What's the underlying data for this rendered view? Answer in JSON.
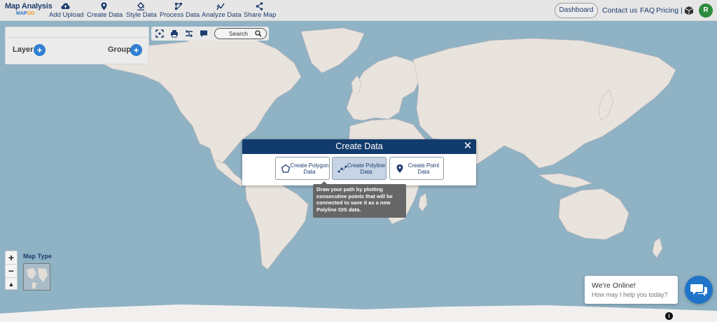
{
  "brand": {
    "title": "Map Analysis",
    "sub_prefix": "MAP",
    "sub_suffix": "OG"
  },
  "nav": {
    "items": [
      {
        "label": "Add Upload",
        "icon": "cloud-upload-icon"
      },
      {
        "label": "Create Data",
        "icon": "map-pin-icon"
      },
      {
        "label": "Style Data",
        "icon": "paint-bucket-icon"
      },
      {
        "label": "Process Data",
        "icon": "process-icon"
      },
      {
        "label": "Analyze Data",
        "icon": "analyze-icon"
      },
      {
        "label": "Share Map",
        "icon": "share-icon"
      }
    ],
    "dashboard": "Dashboard",
    "contact": "Contact us",
    "faq": "FAQ",
    "pricing": "Pricing |",
    "avatar_letter": "R"
  },
  "layer_panel": {
    "layer_label": "Layer",
    "group_label": "Group"
  },
  "toolbar": {
    "search_placeholder": "Search"
  },
  "modal": {
    "title": "Create Data",
    "close": "✕",
    "options": [
      {
        "label": "Create Polygon Data",
        "icon": "polygon-icon",
        "active": false
      },
      {
        "label": "Create Polyline Data",
        "icon": "polyline-icon",
        "active": true
      },
      {
        "label": "Create Point Data",
        "icon": "map-marker-icon",
        "active": false
      }
    ]
  },
  "tooltip": "Draw your path by plotting consecutive points that will be connected to save it as a new Polyline GIS data.",
  "map_controls": {
    "zoom_in": "+",
    "zoom_out": "−",
    "compass": "▲",
    "map_type_label": "Map Type"
  },
  "chat": {
    "title": "We're Online!",
    "subtitle": "How may I help you today?"
  },
  "colors": {
    "navy": "#123b6d",
    "accent": "#2f7fd1",
    "ocean": "#8fb2c4",
    "land": "#e9e3de",
    "avatar": "#2e8b3e"
  }
}
